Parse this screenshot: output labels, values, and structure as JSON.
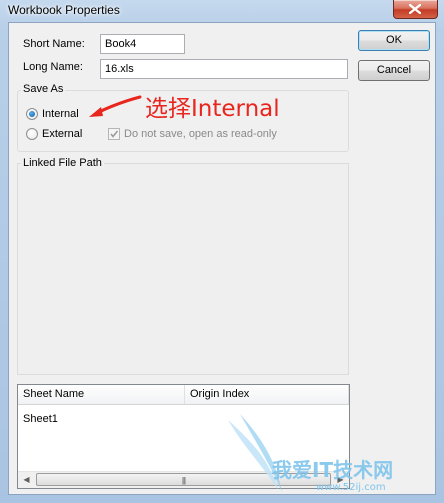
{
  "window": {
    "title": "Workbook Properties"
  },
  "fields": {
    "short_name": {
      "label": "Short Name:",
      "value": "Book4"
    },
    "long_name": {
      "label": "Long Name:",
      "value": "16.xls"
    }
  },
  "buttons": {
    "ok": "OK",
    "cancel": "Cancel"
  },
  "save_as": {
    "title": "Save As",
    "internal": {
      "label": "Internal",
      "checked": true
    },
    "external": {
      "label": "External",
      "checked": false
    },
    "readonly_option": {
      "label": "Do not save, open as read-only",
      "checked": true,
      "enabled": false
    }
  },
  "linked_file_path": {
    "title": "Linked File Path"
  },
  "sheet_list": {
    "columns": [
      "Sheet Name",
      "Origin Index"
    ],
    "rows": [
      {
        "sheet_name": "Sheet1",
        "origin_index": ""
      }
    ]
  },
  "annotation": {
    "text": "选择Internal",
    "color": "#e8261e"
  },
  "watermark": {
    "text": "我爱IT技术网",
    "url": "www.52ij.com"
  },
  "icons": {
    "close": "close-icon",
    "arrow": "red-arrow-icon",
    "check": "checkmark-icon"
  }
}
